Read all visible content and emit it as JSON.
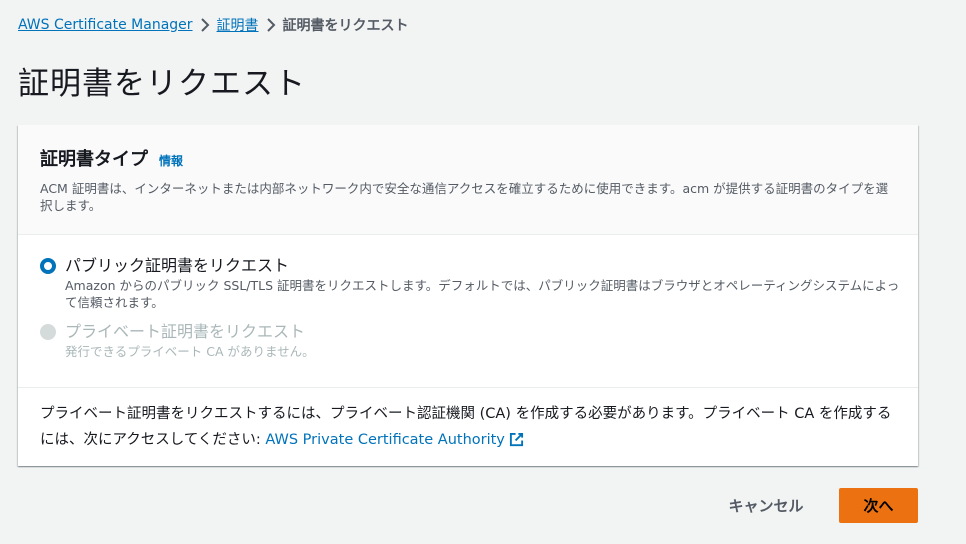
{
  "breadcrumb": {
    "items": [
      "AWS Certificate Manager",
      "証明書"
    ],
    "current": "証明書をリクエスト"
  },
  "page": {
    "title": "証明書をリクエスト"
  },
  "panel": {
    "title": "証明書タイプ",
    "info_label": "情報",
    "description": "ACM 証明書は、インターネットまたは内部ネットワーク内で安全な通信アクセスを確立するために使用できます。acm が提供する証明書のタイプを選択します。",
    "options": [
      {
        "label": "パブリック証明書をリクエスト",
        "description": "Amazon からのパブリック SSL/TLS 証明書をリクエストします。デフォルトでは、パブリック証明書はブラウザとオペレーティングシステムによって信頼されます。",
        "selected": true,
        "disabled": false
      },
      {
        "label": "プライベート証明書をリクエスト",
        "description": "発行できるプライベート CA がありません。",
        "selected": false,
        "disabled": true
      }
    ],
    "note_text": "プライベート証明書をリクエストするには、プライベート認証機関 (CA) を作成する必要があります。プライベート CA を作成するには、次にアクセスしてください: ",
    "note_link": "AWS Private Certificate Authority",
    "note_link_icon": "external-link-icon"
  },
  "actions": {
    "cancel_label": "キャンセル",
    "next_label": "次へ"
  },
  "colors": {
    "link": "#0073bb",
    "primary_button": "#ec7211",
    "background": "#f2f3f3"
  }
}
